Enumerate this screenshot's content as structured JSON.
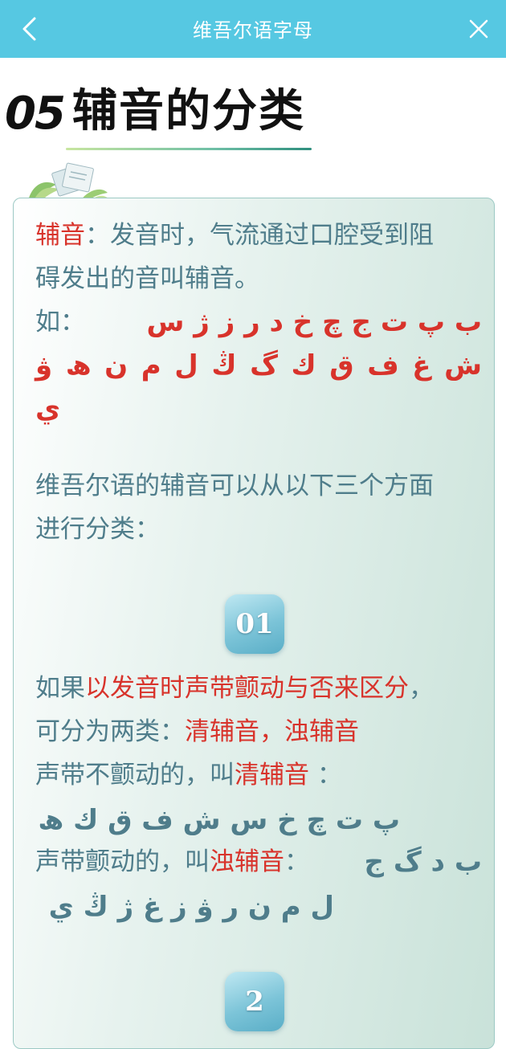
{
  "nav": {
    "title": "维吾尔语字母",
    "back_icon": "chevron-left-icon",
    "close_icon": "close-icon"
  },
  "heading": {
    "number": "05",
    "title": "辅音的分类"
  },
  "intro": {
    "term": "辅音",
    "definition_line1": "：发音时，气流通过口腔受到阻",
    "definition_line2": "碍发出的音叫辅音。",
    "example_label": "如：",
    "letters_line1": "ب پ ت ج چ خ د ر ز ژ س",
    "letters_line2": "ش غ ف ق ك گ ڭ ل م ن ھ ۋ",
    "letters_line3": "ي"
  },
  "classify": {
    "line1": "维吾尔语的辅音可以从以下三个方面",
    "line2": "进行分类："
  },
  "section1": {
    "badge": "01",
    "line1_prefix": "如果",
    "line1_red": "以发音时声带颤动与否来区分",
    "line1_suffix": "，",
    "line2_prefix": "可分为两类：",
    "line2_red": "清辅音，浊辅音",
    "line3_prefix": "声带不颤动的，叫",
    "line3_red": "清辅音",
    "line3_suffix": " ：",
    "voiceless_letters": "پ ت چ خ س ش ف ق ك ھ",
    "line4_prefix": "声带颤动的，叫",
    "line4_red": "浊辅音",
    "line4_suffix": "：",
    "voiced_letters_a": "ب د گ ج",
    "voiced_letters_b": "ل م ن ر ۋ ز غ ژ ڭ ي"
  },
  "section2": {
    "badge": "2"
  },
  "colors": {
    "nav": "#56c8e2",
    "accent_red": "#d8332b",
    "body_teal": "#4f7d8b"
  }
}
